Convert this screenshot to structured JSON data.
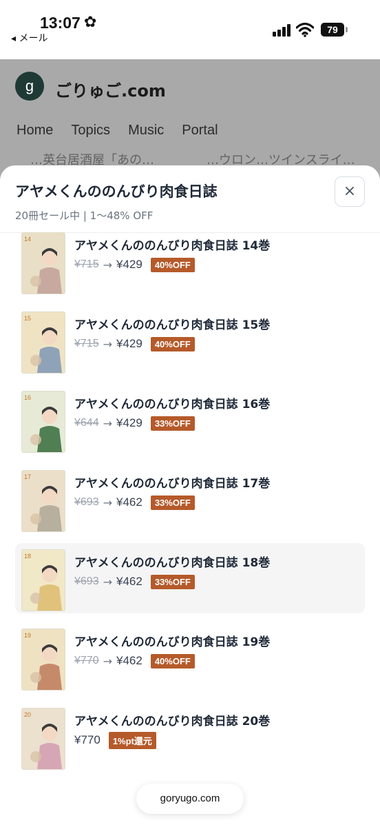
{
  "status_bar": {
    "time": "13:07",
    "back_label": "◂ メール",
    "battery": "79"
  },
  "site": {
    "logo_letter": "g",
    "name": "ごりゅご.com",
    "nav": [
      "Home",
      "Topics",
      "Music",
      "Portal"
    ],
    "peek_left": "…英台居酒屋「あの…",
    "peek_right": "…ウロン…ツインスライ…"
  },
  "sheet": {
    "title": "アヤメくんののんびり肉食日誌",
    "subtitle": "20冊セール中 | 1〜48% OFF",
    "close_label": "×",
    "items": [
      {
        "title": "アヤメくんののんびり肉食日誌 14巻",
        "old_price": "¥715",
        "arrow": "→",
        "new_price": "¥429",
        "badge": "40%OFF",
        "vol": "14"
      },
      {
        "title": "アヤメくんののんびり肉食日誌 15巻",
        "old_price": "¥715",
        "arrow": "→",
        "new_price": "¥429",
        "badge": "40%OFF",
        "vol": "15"
      },
      {
        "title": "アヤメくんののんびり肉食日誌 16巻",
        "old_price": "¥644",
        "arrow": "→",
        "new_price": "¥429",
        "badge": "33%OFF",
        "vol": "16"
      },
      {
        "title": "アヤメくんののんびり肉食日誌 17巻",
        "old_price": "¥693",
        "arrow": "→",
        "new_price": "¥462",
        "badge": "33%OFF",
        "vol": "17"
      },
      {
        "title": "アヤメくんののんびり肉食日誌 18巻",
        "old_price": "¥693",
        "arrow": "→",
        "new_price": "¥462",
        "badge": "33%OFF",
        "vol": "18"
      },
      {
        "title": "アヤメくんののんびり肉食日誌 19巻",
        "old_price": "¥770",
        "arrow": "→",
        "new_price": "¥462",
        "badge": "40%OFF",
        "vol": "19"
      },
      {
        "title": "アヤメくんののんびり肉食日誌 20巻",
        "old_price": "",
        "arrow": "",
        "new_price": "¥770",
        "badge": "1%pt還元",
        "vol": "20"
      }
    ],
    "highlighted_index": 4
  },
  "footer": {
    "domain": "goryugo.com"
  },
  "colors": {
    "badge": "#b55a2a",
    "overlay": "#a9a9a9",
    "highlight_row": "#f5f5f6"
  },
  "icons": {
    "settings": "gear-icon",
    "signal": "cellular-signal-icon",
    "wifi": "wifi-icon",
    "battery": "battery-icon",
    "close": "close-icon"
  }
}
